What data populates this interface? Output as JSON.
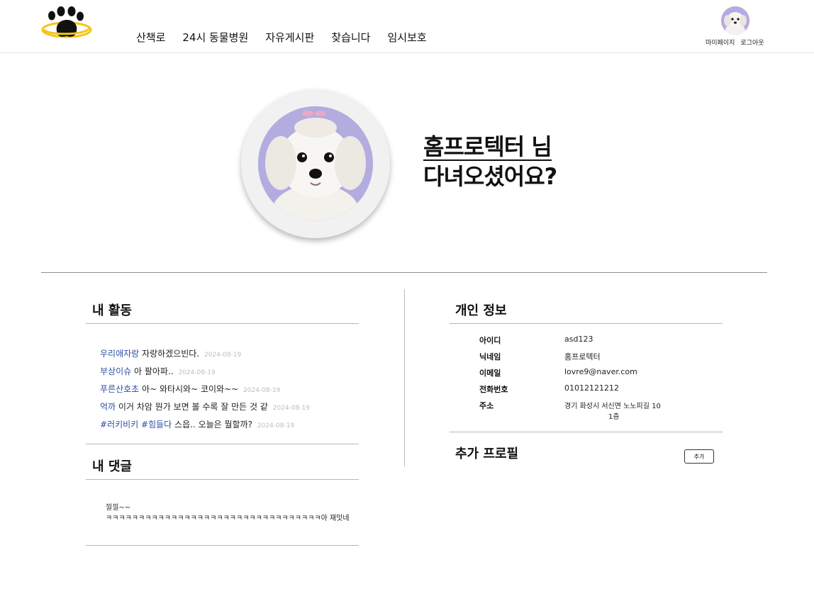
{
  "header": {
    "nav": [
      {
        "label": "산책로"
      },
      {
        "label": "24시 동물병원"
      },
      {
        "label": "자유게시판"
      },
      {
        "label": "찾습니다"
      },
      {
        "label": "임시보호"
      }
    ],
    "mypage_label": "마이페이지",
    "logout_label": "로그아웃"
  },
  "hero": {
    "greeting_line1": "홈프로텍터 님",
    "greeting_line2": "다녀오셨어요?"
  },
  "activity": {
    "title": "내 활동",
    "items": [
      {
        "board": "우리애자랑",
        "text": "자랑하겠으빈다.",
        "date": "2024-08-19"
      },
      {
        "board": "부상이슈",
        "text": "아 팔아파..",
        "date": "2024-08-19"
      },
      {
        "board": "푸른산호초",
        "text": "아~ 와타시와~ 코이와~~",
        "date": "2024-08-19"
      },
      {
        "board": "억까",
        "text": "이거 차암 뭔가 보면 볼 수록 잘 만든 것 같",
        "date": "2024-08-19"
      },
      {
        "board": "#러키비키 #힘들다",
        "text": "스읍.. 오늘은 뭘할까?",
        "date": "2024-08-19"
      }
    ]
  },
  "comments": {
    "title": "내 댓글",
    "items": [
      {
        "line1": "낄낄~~",
        "line2": "ㅋㅋㅋㅋㅋㅋㅋㅋㅋㅋㅋㅋㅋㅋㅋㅋㅋㅋㅋㅋㅋㅋㅋㅋㅋㅋㅋㅋㅋㅋㅋㅋㅋ아 재밋네"
      }
    ]
  },
  "personal_info": {
    "title": "개인 정보",
    "rows": [
      {
        "label": "아이디",
        "value": "asd123"
      },
      {
        "label": "닉네임",
        "value": "홈프로텍터"
      },
      {
        "label": "이메일",
        "value": "lovre9@naver.com"
      },
      {
        "label": "전화번호",
        "value": "01012121212"
      },
      {
        "label": "주소",
        "value": "경기 화성시 서신면 노노피길 10"
      }
    ],
    "address_line2": "1층"
  },
  "extra_profile": {
    "title": "추가 프로필",
    "add_label": "추가"
  },
  "colors": {
    "accent_blue": "#2b4fa6",
    "logo_ring": "#f5c518",
    "avatar_bg": "#b3acdf"
  },
  "icons": {
    "logo": "paw-planet-logo",
    "avatar": "maltese-dog-avatar"
  }
}
